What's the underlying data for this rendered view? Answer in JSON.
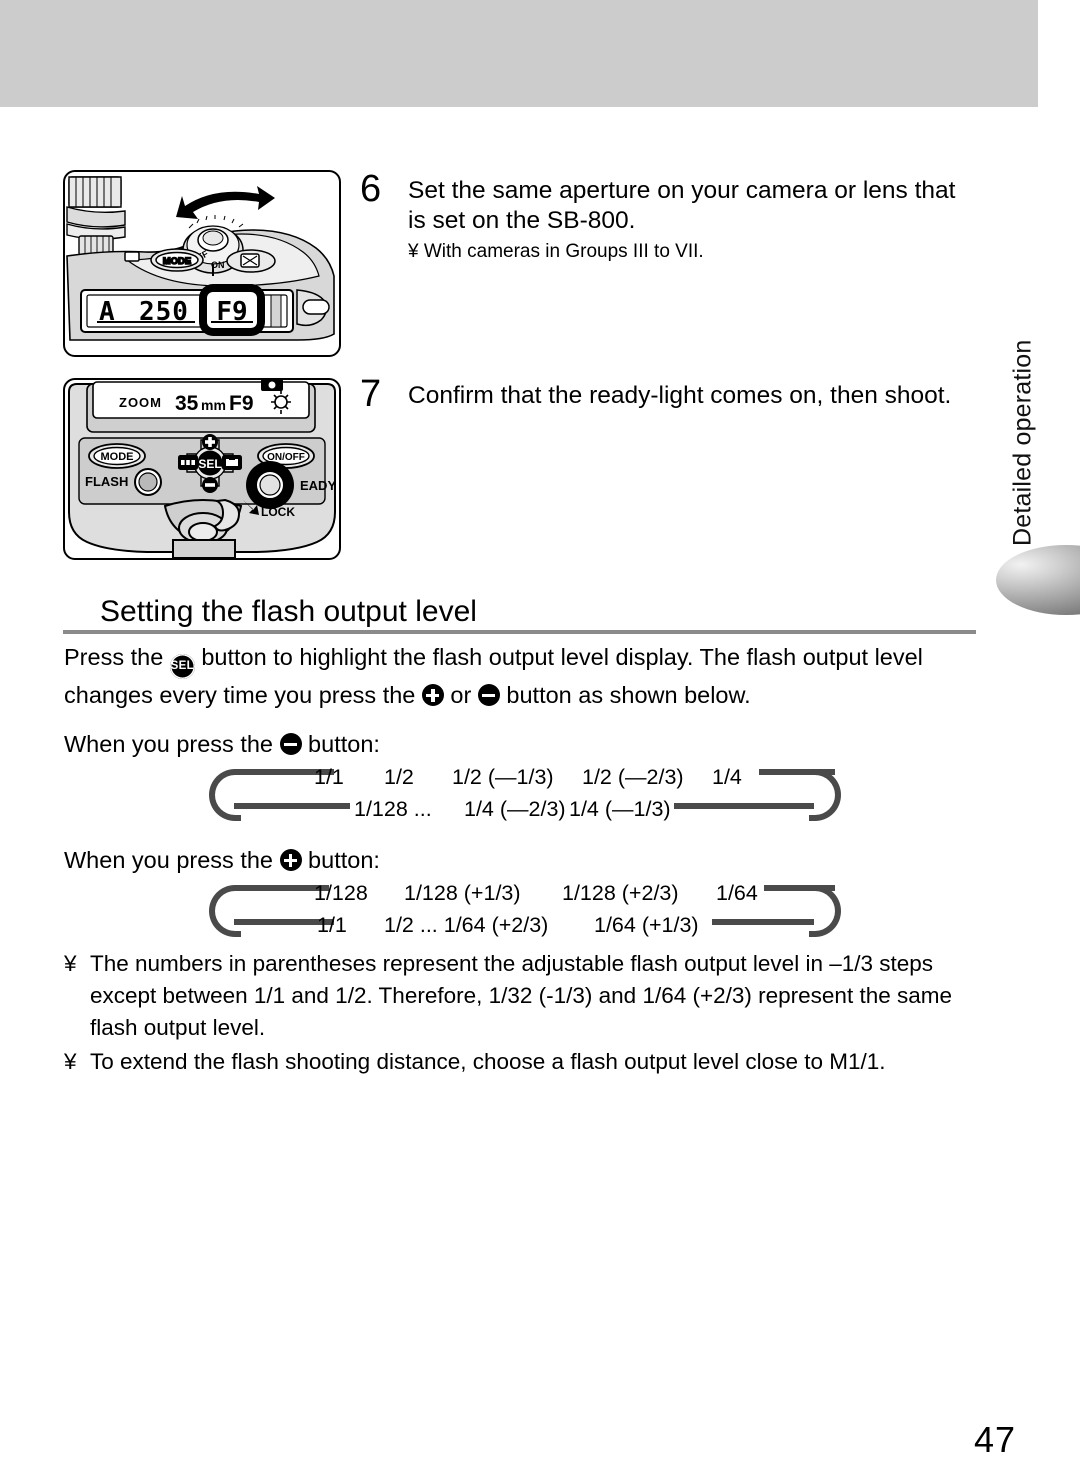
{
  "page": {
    "number": "47",
    "side_tab_label": "Detailed operation"
  },
  "steps": [
    {
      "number": "6",
      "title": "Set the same aperture on your camera or lens that is set on the SB-800.",
      "note_mark": "¥",
      "note": "With cameras in Groups III to VII."
    },
    {
      "number": "7",
      "title": "Confirm that the ready-light comes on, then shoot.",
      "note_mark": "",
      "note": ""
    }
  ],
  "section": {
    "heading": "Setting the flash output level",
    "intro_part1": "Press the ",
    "intro_sel_label": "SEL",
    "intro_part2": " button to highlight the flash output level display. The flash output level changes every time you press the ",
    "intro_or": " or ",
    "intro_part3": " button as shown below."
  },
  "sequences": [
    {
      "id": "minus",
      "button": "minus",
      "caption_prefix": "When you press the ",
      "caption_suffix": " button:",
      "top_row": [
        "1/1",
        "1/2",
        "1/2 (—1/3)",
        "1/2 (—2/3)",
        "1/4"
      ],
      "bottom_row": [
        "1/128 ...",
        "1/4 (—2/3)",
        "1/4 (—1/3)"
      ]
    },
    {
      "id": "plus",
      "button": "plus",
      "caption_prefix": "When you press the ",
      "caption_suffix": " button:",
      "top_row": [
        "1/128",
        "1/128 (+1/3)",
        "1/128 (+2/3)",
        "1/64"
      ],
      "bottom_row": [
        "1/1",
        "1/2 ... 1/64 (+2/3)",
        "1/64 (+1/3)"
      ]
    }
  ],
  "notes": [
    {
      "mark": "¥",
      "text": "The numbers in parentheses represent the adjustable flash output level in –1/3 steps except between 1/1 and 1/2. Therefore, 1/32 (-1/3) and 1/64 (+2/3) represent the same flash output level."
    },
    {
      "mark": "¥",
      "text": "To extend the flash shooting distance, choose a flash output level close to M1/1."
    }
  ],
  "illustrations": {
    "camera": {
      "lcd_mode": "A",
      "lcd_shutter": "250",
      "lcd_aperture": "F9",
      "dial_off": "OFF",
      "dial_on": "ON",
      "button_mode": "MODE",
      "button_exposure": "☒"
    },
    "flash": {
      "lcd_zoom_label": "ZOOM",
      "lcd_focal": "35mm",
      "lcd_aperture": "F9",
      "button_mode": "MODE",
      "button_onoff": "ON/OFF",
      "button_sel": "SEL",
      "label_flash": "FLASH",
      "label_ready": "EADY",
      "label_lock": "LOCK"
    }
  },
  "colors": {
    "band_gray": "#cccccc",
    "rule_gray": "#8a8a8a",
    "connector_gray": "#4a4a4a",
    "panel_gray": "#d0d0d0"
  }
}
